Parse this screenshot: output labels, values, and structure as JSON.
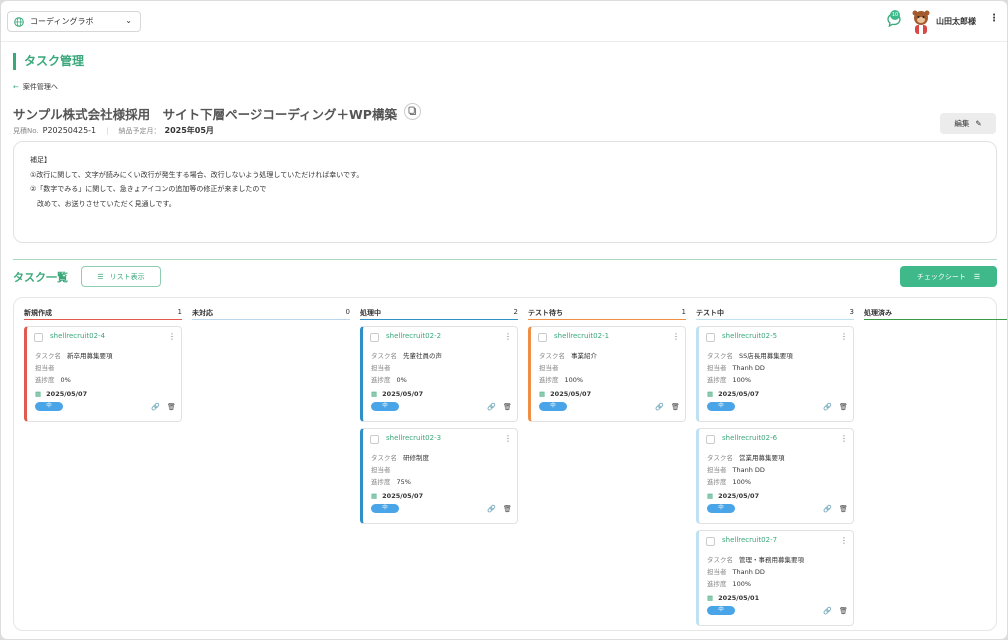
{
  "header": {
    "workspace": "コーディングラボ",
    "chat_badge": "10",
    "user": "山田太郎様"
  },
  "page_title": "タスク管理",
  "back_link": "案件管理へ",
  "project": {
    "title": "サンプル株式会社様採用　サイト下層ページコーディング＋WP構築",
    "estimate_label": "見積No.",
    "estimate_no": "P20250425-1",
    "delivery_label": "納品予定月：",
    "delivery": "2025年05月",
    "edit_label": "編集"
  },
  "note": "補足】\n①改行に関して、文字が読みにくい改行が発生する場合、改行しないよう処理していただければ幸いです。\n②「数字でみる」に関して、急きょアイコンの追加等の修正が来ましたので\n　改めて、お送りさせていただく見通しです。",
  "tasks_section": {
    "title": "タスク一覧",
    "list_button": "リスト表示",
    "checksheet_button": "チェックシート"
  },
  "labels": {
    "task_name": "タスク名",
    "assignee": "担当者",
    "progress": "進捗度",
    "priority": "中"
  },
  "columns": [
    {
      "name": "新規作成",
      "count": "1",
      "color": "#e05a4f"
    },
    {
      "name": "未対応",
      "count": "0",
      "color": "#bcd6ee"
    },
    {
      "name": "処理中",
      "count": "2",
      "color": "#2f8fc7"
    },
    {
      "name": "テスト待ち",
      "count": "1",
      "color": "#ef8f45"
    },
    {
      "name": "テスト中",
      "count": "3",
      "color": "#bfe1f2"
    },
    {
      "name": "処理済み",
      "count": "",
      "color": "#3a9a46"
    }
  ],
  "cards": [
    {
      "col": 0,
      "id": "shellrecruit02-4",
      "name": "新卒用募集要項",
      "assignee": "",
      "progress": "0%",
      "date": "2025/05/07"
    },
    {
      "col": 2,
      "id": "shellrecruit02-2",
      "name": "先輩社員の声",
      "assignee": "",
      "progress": "0%",
      "date": "2025/05/07"
    },
    {
      "col": 2,
      "id": "shellrecruit02-3",
      "name": "研修制度",
      "assignee": "",
      "progress": "75%",
      "date": "2025/05/07"
    },
    {
      "col": 3,
      "id": "shellrecruit02-1",
      "name": "事業紹介",
      "assignee": "",
      "progress": "100%",
      "date": "2025/05/07"
    },
    {
      "col": 4,
      "id": "shellrecruit02-5",
      "name": "SS店長用募集要項",
      "assignee": "Thanh DD",
      "progress": "100%",
      "date": "2025/05/07"
    },
    {
      "col": 4,
      "id": "shellrecruit02-6",
      "name": "営業用募集要項",
      "assignee": "Thanh DD",
      "progress": "100%",
      "date": "2025/05/07"
    },
    {
      "col": 4,
      "id": "shellrecruit02-7",
      "name": "管理・事務用募集要項",
      "assignee": "Thanh DD",
      "progress": "100%",
      "date": "2025/05/01"
    }
  ]
}
